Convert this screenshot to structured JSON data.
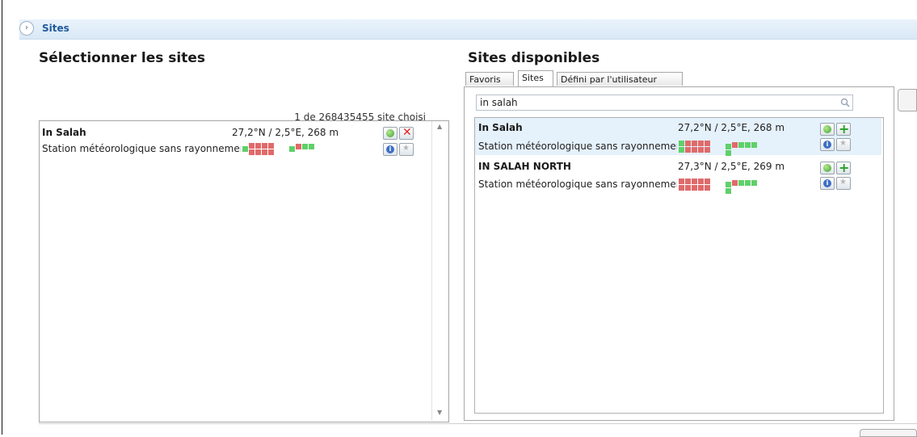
{
  "header": {
    "title": "Sites",
    "collapse_glyph": "›"
  },
  "left_panel": {
    "heading": "Sélectionner les sites",
    "count_label": "1 de 268435455 site choisi",
    "items": [
      {
        "name": "In Salah",
        "coords": "27,2°N / 2,5°E, 268 m",
        "type": "Station météorologique sans rayonnement"
      }
    ]
  },
  "right_panel": {
    "heading": "Sites disponibles",
    "tabs": [
      {
        "label": "Favoris"
      },
      {
        "label": "Sites"
      },
      {
        "label": "Défini par l'utilisateur"
      }
    ],
    "active_tab": "Sites",
    "search": {
      "value": "in salah"
    },
    "items": [
      {
        "name": "In Salah",
        "coords": "27,2°N / 2,5°E, 268 m",
        "type": "Station météorologique sans rayonnement"
      },
      {
        "name": "IN SALAH NORTH",
        "coords": "27,3°N / 2,5°E, 269 m",
        "type": "Station météorologique sans rayonnement"
      }
    ]
  },
  "icons": {
    "map": "globe-icon",
    "remove": "remove-icon",
    "add": "add-icon",
    "info": "info-icon",
    "favorite": "favorite-star-icon",
    "search": "search-icon"
  },
  "colors": {
    "header_text": "#1e5a9c",
    "data_missing": "#e06a6a",
    "data_available": "#5fd06a",
    "selected_row": "#e5f1fb"
  }
}
